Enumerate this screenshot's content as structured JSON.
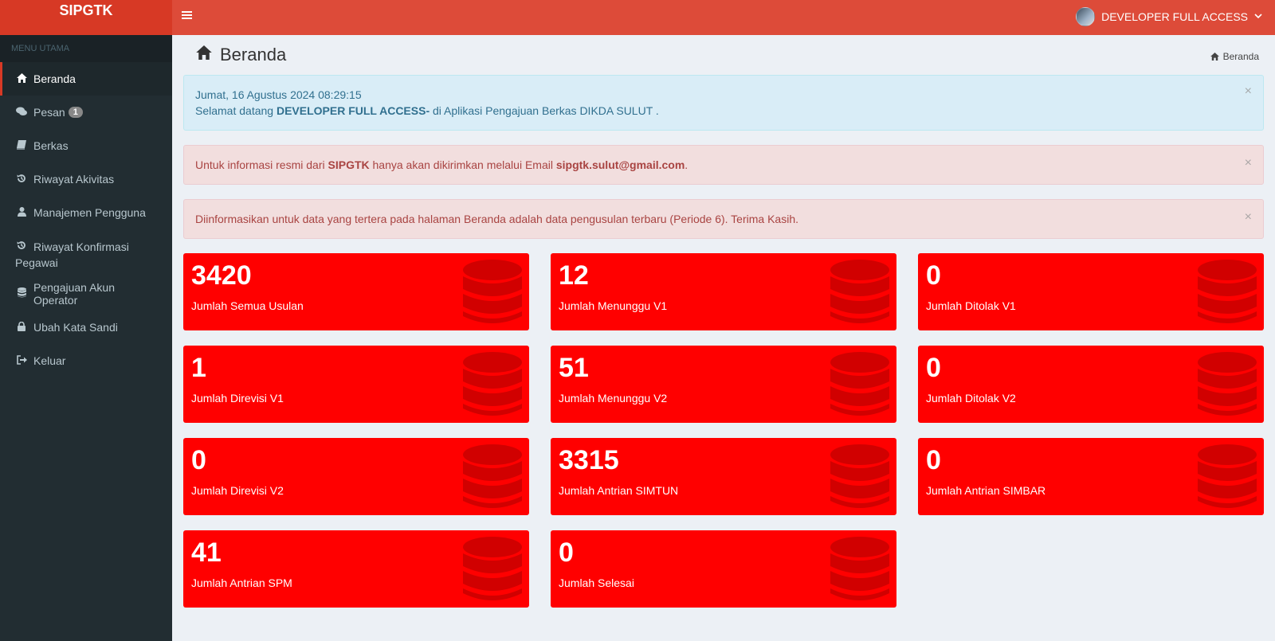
{
  "app": {
    "logo": "SIPGTK"
  },
  "topbar": {
    "toggle_icon": "bars-icon",
    "user_name": "DEVELOPER FULL ACCESS",
    "caret": "⌄"
  },
  "sidebar": {
    "header": "MENU UTAMA",
    "items": [
      {
        "label": "Beranda",
        "icon": "home-icon",
        "active": true
      },
      {
        "label": "Pesan",
        "icon": "comments-icon",
        "badge": "1"
      },
      {
        "label": "Berkas",
        "icon": "book-icon"
      },
      {
        "label": "Riwayat Akivitas",
        "icon": "history-icon"
      },
      {
        "label": "Manajemen Pengguna",
        "icon": "user-icon"
      },
      {
        "label": "Riwayat Konfirmasi Pegawai",
        "icon": "history-icon"
      },
      {
        "label": "Pengajuan Akun Operator",
        "icon": "database-icon"
      },
      {
        "label": "Ubah Kata Sandi",
        "icon": "lock-icon"
      },
      {
        "label": "Keluar",
        "icon": "sign-out-icon"
      }
    ]
  },
  "page": {
    "title": "Beranda",
    "breadcrumb": "Beranda"
  },
  "alerts": {
    "info": {
      "datetime": "Jumat, 16 Agustus 2024 08:29:15",
      "greeting_prefix": "Selamat datang ",
      "greeting_user": "DEVELOPER FULL ACCESS-",
      "greeting_suffix": " di Aplikasi Pengajuan Berkas DIKDA SULUT ."
    },
    "email": {
      "prefix": "Untuk informasi resmi dari ",
      "app": "SIPGTK",
      "middle": " hanya akan dikirimkan melalui Email ",
      "email": "sipgtk.sulut@gmail.com",
      "suffix": "."
    },
    "notice": {
      "text": "Diinformasikan untuk data yang tertera pada halaman Beranda adalah data pengusulan terbaru (Periode 6). Terima Kasih."
    },
    "close": "×"
  },
  "stats": [
    {
      "value": "3420",
      "label": "Jumlah Semua Usulan"
    },
    {
      "value": "12",
      "label": "Jumlah Menunggu V1"
    },
    {
      "value": "0",
      "label": "Jumlah Ditolak V1"
    },
    {
      "value": "1",
      "label": "Jumlah Direvisi V1"
    },
    {
      "value": "51",
      "label": "Jumlah Menunggu V2"
    },
    {
      "value": "0",
      "label": "Jumlah Ditolak V2"
    },
    {
      "value": "0",
      "label": "Jumlah Direvisi V2"
    },
    {
      "value": "3315",
      "label": "Jumlah Antrian SIMTUN"
    },
    {
      "value": "0",
      "label": "Jumlah Antrian SIMBAR"
    },
    {
      "value": "41",
      "label": "Jumlah Antrian SPM"
    },
    {
      "value": "0",
      "label": "Jumlah Selesai"
    }
  ],
  "colors": {
    "header": "#dd4b39",
    "logo": "#d73925",
    "sidebar": "#222d32",
    "stat_box": "#ff0000",
    "background": "#ecf0f5"
  }
}
